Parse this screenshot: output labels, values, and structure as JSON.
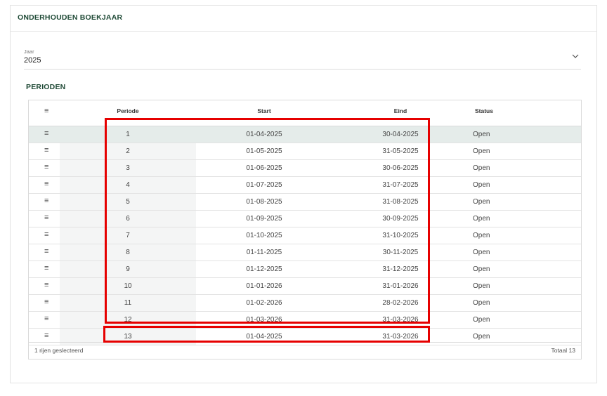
{
  "card": {
    "title": "ONDERHOUDEN BOEKJAAR"
  },
  "year_field": {
    "label": "Jaar",
    "value": "2025"
  },
  "section": {
    "title": "PERIODEN"
  },
  "grid": {
    "columns": [
      "Periode",
      "Start",
      "Eind",
      "Status"
    ],
    "rows": [
      {
        "periode": "1",
        "start": "01-04-2025",
        "eind": "30-04-2025",
        "status": "Open"
      },
      {
        "periode": "2",
        "start": "01-05-2025",
        "eind": "31-05-2025",
        "status": "Open"
      },
      {
        "periode": "3",
        "start": "01-06-2025",
        "eind": "30-06-2025",
        "status": "Open"
      },
      {
        "periode": "4",
        "start": "01-07-2025",
        "eind": "31-07-2025",
        "status": "Open"
      },
      {
        "periode": "5",
        "start": "01-08-2025",
        "eind": "31-08-2025",
        "status": "Open"
      },
      {
        "periode": "6",
        "start": "01-09-2025",
        "eind": "30-09-2025",
        "status": "Open"
      },
      {
        "periode": "7",
        "start": "01-10-2025",
        "eind": "31-10-2025",
        "status": "Open"
      },
      {
        "periode": "8",
        "start": "01-11-2025",
        "eind": "30-11-2025",
        "status": "Open"
      },
      {
        "periode": "9",
        "start": "01-12-2025",
        "eind": "31-12-2025",
        "status": "Open"
      },
      {
        "periode": "10",
        "start": "01-01-2026",
        "eind": "31-01-2026",
        "status": "Open"
      },
      {
        "periode": "11",
        "start": "01-02-2026",
        "eind": "28-02-2026",
        "status": "Open"
      },
      {
        "periode": "12",
        "start": "01-03-2026",
        "eind": "31-03-2026",
        "status": "Open"
      },
      {
        "periode": "13",
        "start": "01-04-2025",
        "eind": "31-03-2026",
        "status": "Open"
      }
    ],
    "footer_left": "1 rijen geslecteerd",
    "footer_right": "Totaal 13"
  },
  "colors": {
    "accent": "#1f4a36",
    "highlight": "#e60000",
    "selected_row": "#e5ecea"
  },
  "icons": {
    "row_handle": "menu-lines-icon",
    "chevron": "chevron-down-icon"
  }
}
